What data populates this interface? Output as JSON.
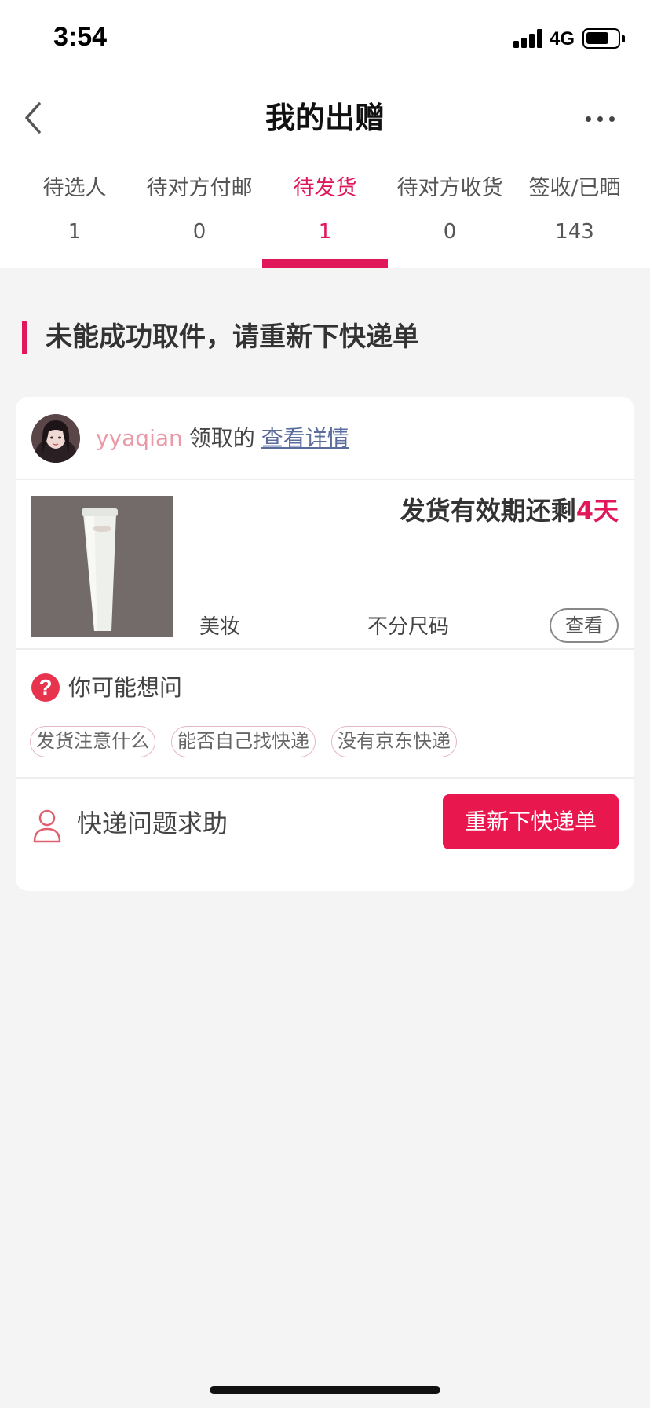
{
  "status_bar": {
    "time": "3:54",
    "network": "4G",
    "signal_icon": "signal-icon",
    "battery_icon": "battery-icon"
  },
  "nav": {
    "title": "我的出赠",
    "back_icon": "chevron-left-icon",
    "more_icon": "more-dots-icon"
  },
  "tabs": [
    {
      "label": "待选人",
      "count": "1",
      "active": false
    },
    {
      "label": "待对方付邮",
      "count": "0",
      "active": false
    },
    {
      "label": "待发货",
      "count": "1",
      "active": true
    },
    {
      "label": "待对方收货",
      "count": "0",
      "active": false
    },
    {
      "label": "签收/已晒",
      "count": "143",
      "active": false
    }
  ],
  "notice": {
    "text": "未能成功取件，请重新下快递单"
  },
  "order": {
    "username": "yyaqian",
    "claimed_text": "领取的",
    "detail_link": "查看详情",
    "deadline_prefix": "发货有效期还剩",
    "deadline_days": "4天",
    "category": "美妆",
    "size": "不分尺码",
    "view_button": "查看"
  },
  "faq": {
    "title": "你可能想问",
    "icon": "question-circle-icon",
    "questions": [
      "发货注意什么",
      "能否自己找快递",
      "没有京东快递"
    ]
  },
  "help": {
    "icon": "person-icon",
    "text": "快递问题求助",
    "button": "重新下快递单"
  },
  "colors": {
    "accent": "#e0185a",
    "button": "#e8184f",
    "username": "#e99aa6",
    "link": "#5a6c9c",
    "background": "#f4f4f4"
  }
}
